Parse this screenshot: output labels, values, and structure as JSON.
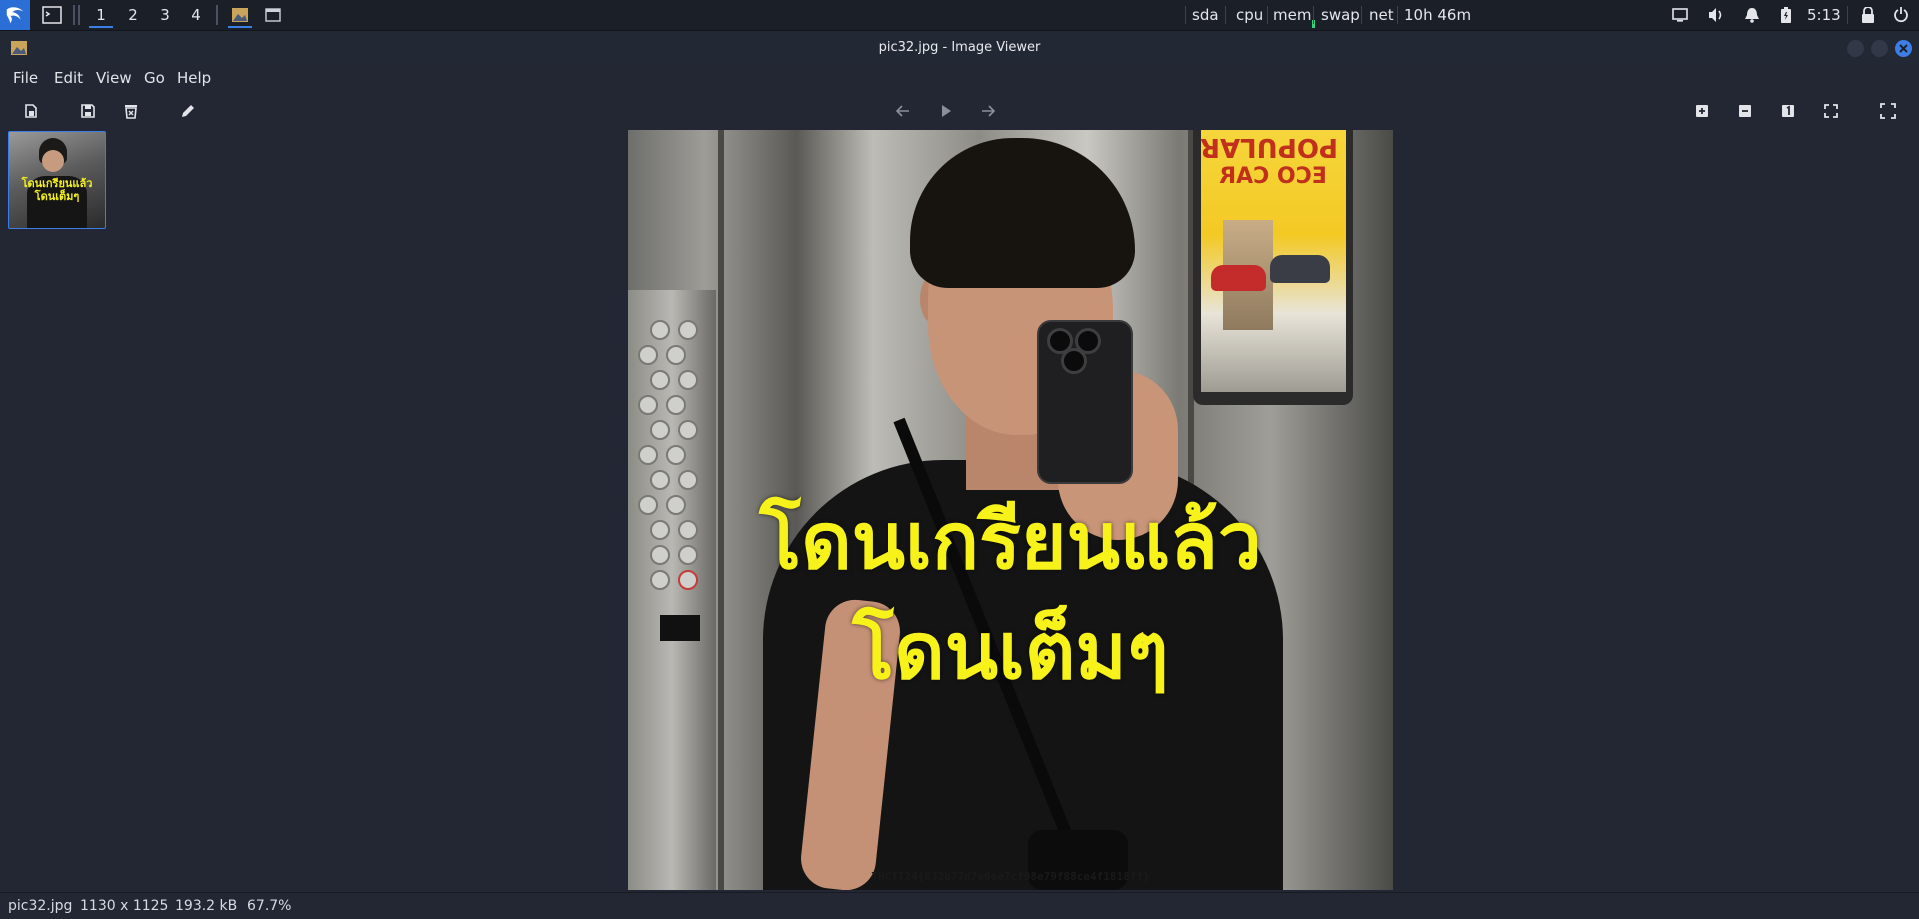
{
  "panel": {
    "workspaces": [
      "1",
      "2",
      "3",
      "4"
    ],
    "active_workspace": "1",
    "monitors": {
      "sda": "sda",
      "cpu": "cpu",
      "mem": "mem",
      "swap": "swap",
      "net": "net",
      "uptime": "10h 46m"
    },
    "clock": "5:13",
    "accent": "#3d7ee6",
    "tray_icons": [
      "display-icon",
      "volume-icon",
      "bell-icon",
      "battery-icon",
      "lock-icon",
      "power-icon"
    ]
  },
  "window": {
    "title": "pic32.jpg - Image Viewer"
  },
  "menu": {
    "file": "File",
    "edit": "Edit",
    "view": "View",
    "go": "Go",
    "help": "Help"
  },
  "toolbar": {
    "left": [
      "open-icon",
      "save-icon",
      "delete-icon",
      "edit-icon"
    ],
    "center": [
      "back-icon",
      "play-icon",
      "forward-icon"
    ],
    "right": [
      "zoom-in-icon",
      "zoom-out-icon",
      "zoom-1-icon",
      "fit-icon",
      "fullscreen-icon"
    ]
  },
  "thumbnail": {
    "text_line1": "โดนเกรียนแล้ว",
    "text_line2": "โดนเต็มๆ"
  },
  "image": {
    "caption_line1": "โดนเกรียนแล้ว",
    "caption_line2": "โดนเต็มๆ",
    "ad_line1": "POPULAR",
    "ad_line2": "ECO CAR",
    "watermark": "THCTT24{832b77d7e6ee7cf98e79f88ce4f1818ff}",
    "caption_color": "#f6f21a"
  },
  "status": {
    "filename": "pic32.jpg",
    "dimensions": "1130 x 1125",
    "filesize": "193.2 kB",
    "zoom": "67.7%"
  }
}
